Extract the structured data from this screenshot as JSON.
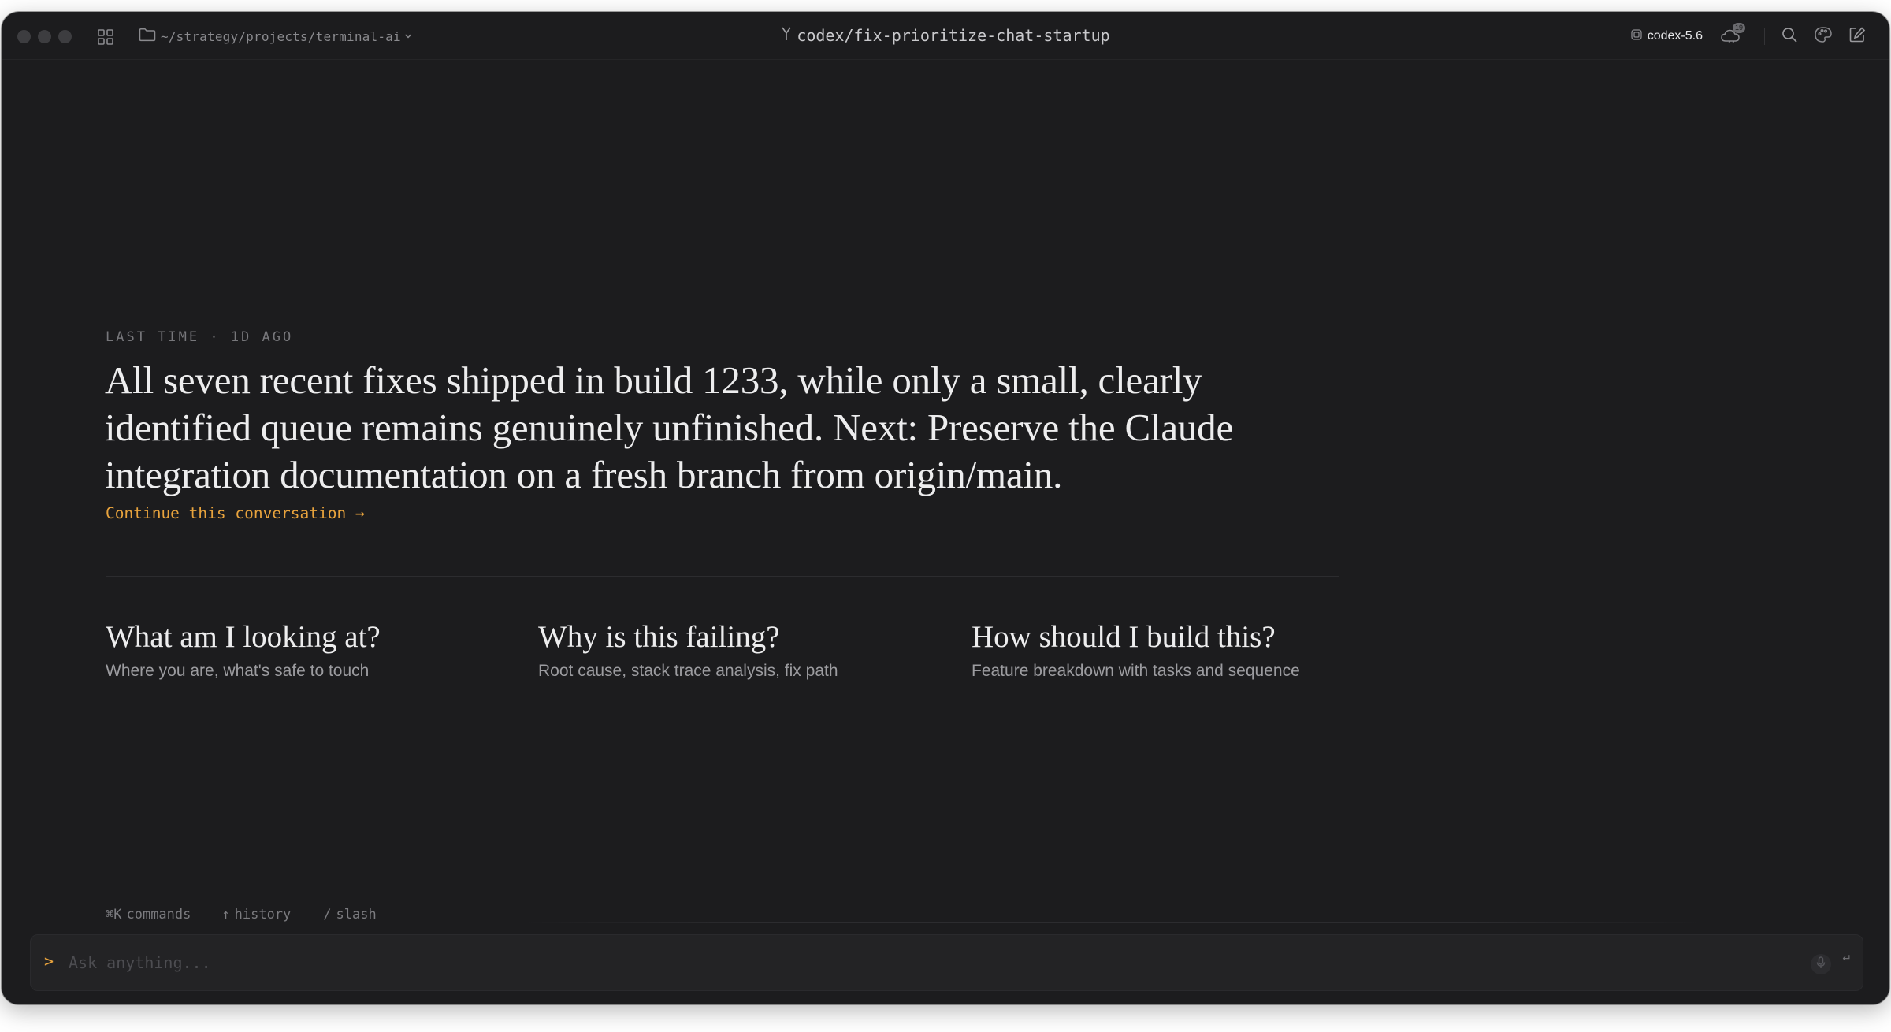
{
  "titlebar": {
    "project_path": "~/strategy/projects/terminal-ai",
    "branch": "codex/fix-prioritize-chat-startup",
    "model": "codex-5.6",
    "cloud_badge": "19"
  },
  "last_session": {
    "kicker": "LAST TIME · 1D AGO",
    "summary": "All seven recent fixes shipped in build 1233, while only a small, clearly identified queue remains genuinely unfinished. Next: Preserve the Claude integration documentation on a fresh branch from origin/main.",
    "continue_label": "Continue this conversation →"
  },
  "suggestions": [
    {
      "title": "What am I looking at?",
      "description": "Where you are, what's safe to touch"
    },
    {
      "title": "Why is this failing?",
      "description": "Root cause, stack trace analysis, fix path"
    },
    {
      "title": "How should I build this?",
      "description": "Feature breakdown with tasks and sequence"
    }
  ],
  "hints": [
    {
      "glyph": "⌘K",
      "label": "commands"
    },
    {
      "glyph": "↑",
      "label": "history"
    },
    {
      "glyph": "/",
      "label": "slash"
    }
  ],
  "input": {
    "prompt_symbol": ">",
    "placeholder": "Ask anything...",
    "submit_glyph": "↵"
  },
  "colors": {
    "window_bg": "#1c1c1e",
    "accent": "#e8a33d",
    "text_primary": "#ededee",
    "text_muted": "#9c9ca0"
  },
  "icons": {
    "traffic_lights": [
      "close-dot",
      "minimize-dot",
      "zoom-dot"
    ],
    "toolbar": [
      "layout-grid-icon",
      "folder-icon",
      "branch-icon",
      "model-chip-icon",
      "cloud-icon",
      "search-icon",
      "palette-icon",
      "compose-icon",
      "mic-icon"
    ]
  }
}
